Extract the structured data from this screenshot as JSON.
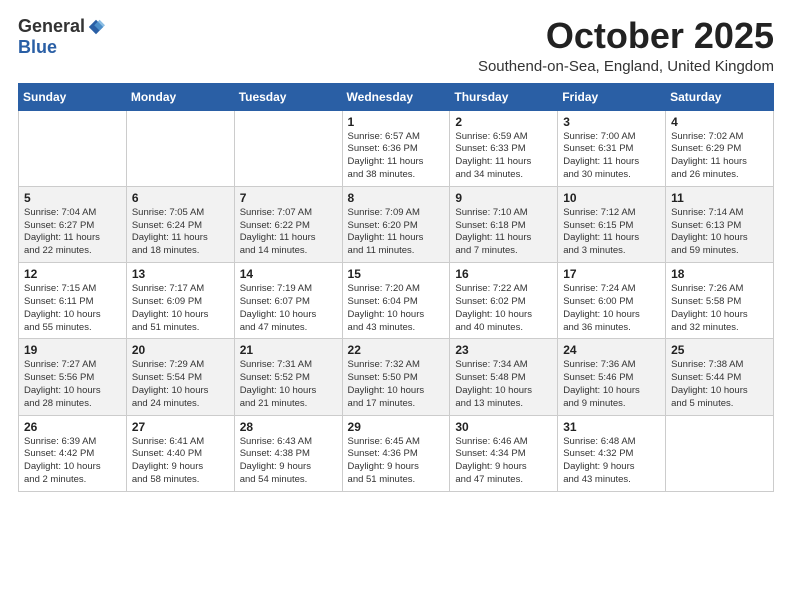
{
  "header": {
    "logo_general": "General",
    "logo_blue": "Blue",
    "month": "October 2025",
    "location": "Southend-on-Sea, England, United Kingdom"
  },
  "days_of_week": [
    "Sunday",
    "Monday",
    "Tuesday",
    "Wednesday",
    "Thursday",
    "Friday",
    "Saturday"
  ],
  "weeks": [
    [
      {
        "day": "",
        "info": ""
      },
      {
        "day": "",
        "info": ""
      },
      {
        "day": "",
        "info": ""
      },
      {
        "day": "1",
        "info": "Sunrise: 6:57 AM\nSunset: 6:36 PM\nDaylight: 11 hours\nand 38 minutes."
      },
      {
        "day": "2",
        "info": "Sunrise: 6:59 AM\nSunset: 6:33 PM\nDaylight: 11 hours\nand 34 minutes."
      },
      {
        "day": "3",
        "info": "Sunrise: 7:00 AM\nSunset: 6:31 PM\nDaylight: 11 hours\nand 30 minutes."
      },
      {
        "day": "4",
        "info": "Sunrise: 7:02 AM\nSunset: 6:29 PM\nDaylight: 11 hours\nand 26 minutes."
      }
    ],
    [
      {
        "day": "5",
        "info": "Sunrise: 7:04 AM\nSunset: 6:27 PM\nDaylight: 11 hours\nand 22 minutes."
      },
      {
        "day": "6",
        "info": "Sunrise: 7:05 AM\nSunset: 6:24 PM\nDaylight: 11 hours\nand 18 minutes."
      },
      {
        "day": "7",
        "info": "Sunrise: 7:07 AM\nSunset: 6:22 PM\nDaylight: 11 hours\nand 14 minutes."
      },
      {
        "day": "8",
        "info": "Sunrise: 7:09 AM\nSunset: 6:20 PM\nDaylight: 11 hours\nand 11 minutes."
      },
      {
        "day": "9",
        "info": "Sunrise: 7:10 AM\nSunset: 6:18 PM\nDaylight: 11 hours\nand 7 minutes."
      },
      {
        "day": "10",
        "info": "Sunrise: 7:12 AM\nSunset: 6:15 PM\nDaylight: 11 hours\nand 3 minutes."
      },
      {
        "day": "11",
        "info": "Sunrise: 7:14 AM\nSunset: 6:13 PM\nDaylight: 10 hours\nand 59 minutes."
      }
    ],
    [
      {
        "day": "12",
        "info": "Sunrise: 7:15 AM\nSunset: 6:11 PM\nDaylight: 10 hours\nand 55 minutes."
      },
      {
        "day": "13",
        "info": "Sunrise: 7:17 AM\nSunset: 6:09 PM\nDaylight: 10 hours\nand 51 minutes."
      },
      {
        "day": "14",
        "info": "Sunrise: 7:19 AM\nSunset: 6:07 PM\nDaylight: 10 hours\nand 47 minutes."
      },
      {
        "day": "15",
        "info": "Sunrise: 7:20 AM\nSunset: 6:04 PM\nDaylight: 10 hours\nand 43 minutes."
      },
      {
        "day": "16",
        "info": "Sunrise: 7:22 AM\nSunset: 6:02 PM\nDaylight: 10 hours\nand 40 minutes."
      },
      {
        "day": "17",
        "info": "Sunrise: 7:24 AM\nSunset: 6:00 PM\nDaylight: 10 hours\nand 36 minutes."
      },
      {
        "day": "18",
        "info": "Sunrise: 7:26 AM\nSunset: 5:58 PM\nDaylight: 10 hours\nand 32 minutes."
      }
    ],
    [
      {
        "day": "19",
        "info": "Sunrise: 7:27 AM\nSunset: 5:56 PM\nDaylight: 10 hours\nand 28 minutes."
      },
      {
        "day": "20",
        "info": "Sunrise: 7:29 AM\nSunset: 5:54 PM\nDaylight: 10 hours\nand 24 minutes."
      },
      {
        "day": "21",
        "info": "Sunrise: 7:31 AM\nSunset: 5:52 PM\nDaylight: 10 hours\nand 21 minutes."
      },
      {
        "day": "22",
        "info": "Sunrise: 7:32 AM\nSunset: 5:50 PM\nDaylight: 10 hours\nand 17 minutes."
      },
      {
        "day": "23",
        "info": "Sunrise: 7:34 AM\nSunset: 5:48 PM\nDaylight: 10 hours\nand 13 minutes."
      },
      {
        "day": "24",
        "info": "Sunrise: 7:36 AM\nSunset: 5:46 PM\nDaylight: 10 hours\nand 9 minutes."
      },
      {
        "day": "25",
        "info": "Sunrise: 7:38 AM\nSunset: 5:44 PM\nDaylight: 10 hours\nand 5 minutes."
      }
    ],
    [
      {
        "day": "26",
        "info": "Sunrise: 6:39 AM\nSunset: 4:42 PM\nDaylight: 10 hours\nand 2 minutes."
      },
      {
        "day": "27",
        "info": "Sunrise: 6:41 AM\nSunset: 4:40 PM\nDaylight: 9 hours\nand 58 minutes."
      },
      {
        "day": "28",
        "info": "Sunrise: 6:43 AM\nSunset: 4:38 PM\nDaylight: 9 hours\nand 54 minutes."
      },
      {
        "day": "29",
        "info": "Sunrise: 6:45 AM\nSunset: 4:36 PM\nDaylight: 9 hours\nand 51 minutes."
      },
      {
        "day": "30",
        "info": "Sunrise: 6:46 AM\nSunset: 4:34 PM\nDaylight: 9 hours\nand 47 minutes."
      },
      {
        "day": "31",
        "info": "Sunrise: 6:48 AM\nSunset: 4:32 PM\nDaylight: 9 hours\nand 43 minutes."
      },
      {
        "day": "",
        "info": ""
      }
    ]
  ]
}
